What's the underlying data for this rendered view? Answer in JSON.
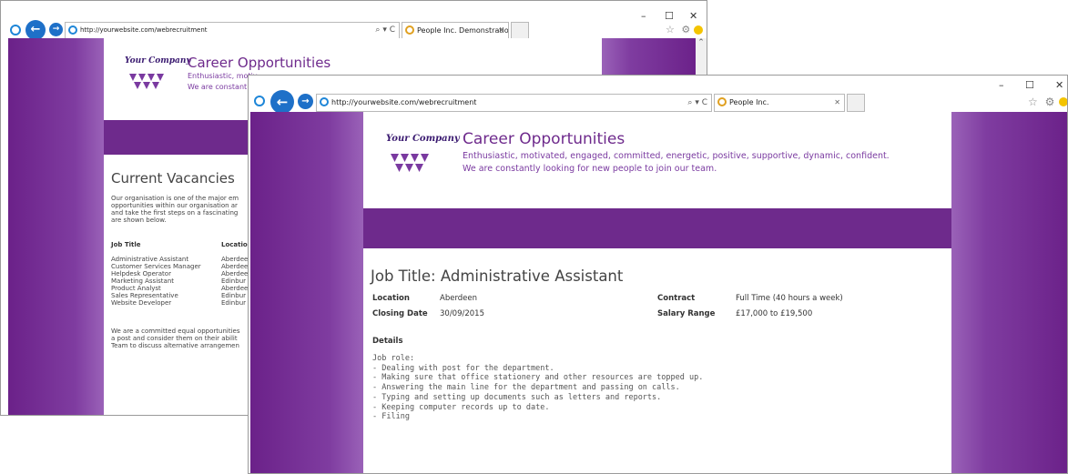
{
  "colors": {
    "purple": "#6e2a8c",
    "header_text": "#6e2a8c",
    "nav_blue": "#1e70c8"
  },
  "back_window": {
    "address": "http://yourwebsite.com/webrecruitment",
    "tab_title": "People Inc. Demonstration ...",
    "company": "Your Company",
    "header_title": "Career Opportunities",
    "tagline_1": "Enthusiastic, motiv",
    "tagline_2": "We are constant",
    "section_title": "Current Vacancies",
    "intro": [
      "Our organisation is one of the major em",
      "opportunities within our organisation ar",
      "and take the first steps on a fascinating",
      "are shown below."
    ],
    "col_job_title": "Job Title",
    "col_location": "Locatio",
    "jobs": [
      {
        "title": "Administrative Assistant",
        "location": "Aberdee"
      },
      {
        "title": "Customer Services Manager",
        "location": "Aberdee"
      },
      {
        "title": "Helpdesk Operator",
        "location": "Aberdee"
      },
      {
        "title": "Marketing Assistant",
        "location": "Edinbur"
      },
      {
        "title": "Product Analyst",
        "location": "Aberdee"
      },
      {
        "title": "Sales Representative",
        "location": "Edinbur"
      },
      {
        "title": "Website Developer",
        "location": "Edinbur"
      }
    ],
    "footer": [
      "We are a committed equal opportunities",
      "a post and consider them on their abilit",
      "Team to discuss alternative arrangemen"
    ]
  },
  "front_window": {
    "address": "http://yourwebsite.com/webrecruitment",
    "tab_title": "People Inc.",
    "company": "Your Company",
    "header_title": "Career Opportunities",
    "tagline_1": "Enthusiastic, motivated, engaged, committed, energetic, positive, supportive, dynamic, confident.",
    "tagline_2": "We are constantly looking for new people to join our team.",
    "job_heading": "Job Title: Administrative Assistant",
    "location_label": "Location",
    "location_value": "Aberdeen",
    "closing_label": "Closing Date",
    "closing_value": "30/09/2015",
    "contract_label": "Contract",
    "contract_value": "Full Time (40 hours a week)",
    "salary_label": "Salary Range",
    "salary_value": "£17,000 to £19,500",
    "details_label": "Details",
    "details_lines": [
      "Job role:",
      "- Dealing with post for the department.",
      "- Making sure that office stationery and other resources are topped up.",
      "- Answering the main line for the department and passing on calls.",
      "- Typing and setting up documents such as letters and reports.",
      "- Keeping computer records up to date.",
      "- Filing"
    ]
  },
  "window_controls": {
    "minimize": "–",
    "maximize": "☐",
    "close": "✕"
  },
  "toolbar": {
    "search_refresh": "⌕ ▾ C",
    "favorites": "☆ ⚙"
  },
  "icons": [
    "back-arrow-icon",
    "forward-arrow-icon",
    "ie-icon",
    "search-icon",
    "refresh-icon",
    "star-icon",
    "gear-icon",
    "smiley-icon",
    "tab-close-icon",
    "scroll-up-icon"
  ]
}
